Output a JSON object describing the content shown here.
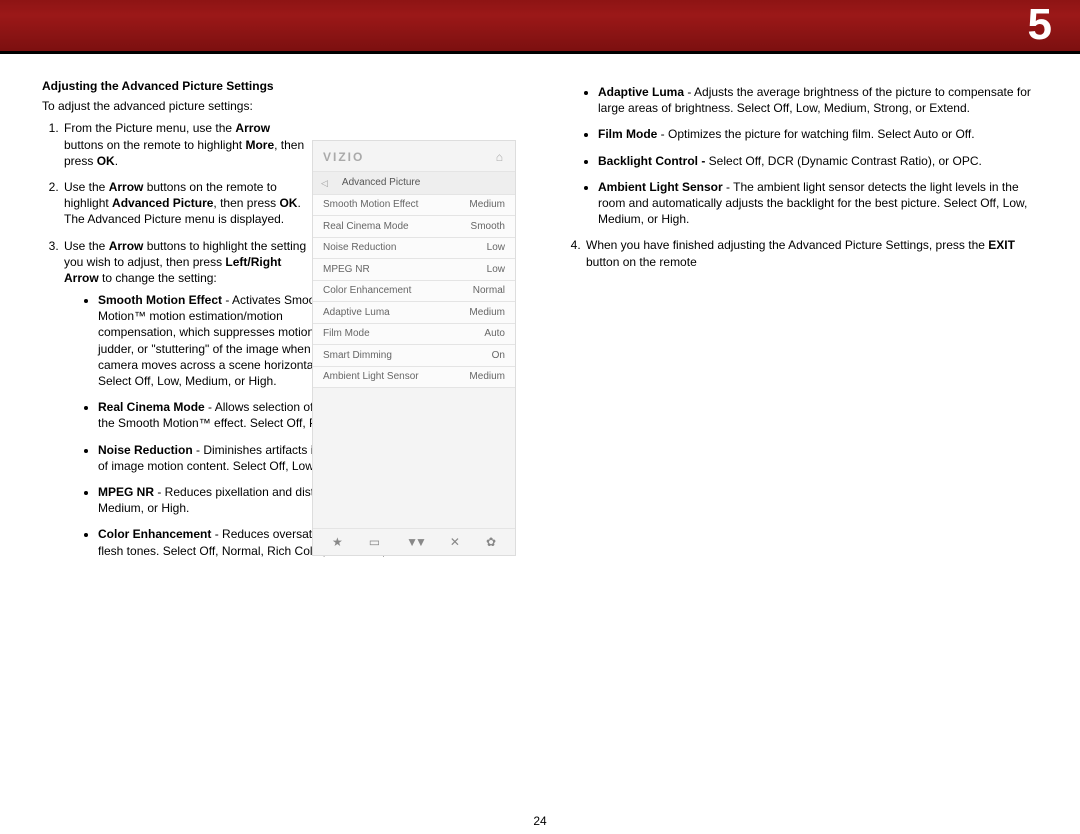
{
  "chapter": "5",
  "page_number": "24",
  "left": {
    "heading": "Adjusting the Advanced Picture Settings",
    "intro": "To adjust the advanced picture settings:",
    "step1_a": "From the Picture menu, use the ",
    "step1_b": "Arrow",
    "step1_c": " buttons on the remote to highlight ",
    "step1_d": "More",
    "step1_e": ", then press ",
    "step1_f": "OK",
    "step1_g": ".",
    "step2_a": "Use the ",
    "step2_b": "Arrow",
    "step2_c": " buttons on the remote to highlight ",
    "step2_d": "Advanced Picture",
    "step2_e": ", then press ",
    "step2_f": "OK",
    "step2_g": ". The Advanced Picture menu is displayed.",
    "step3_a": "Use the ",
    "step3_b": "Arrow",
    "step3_c": " buttons to highlight the setting you wish to adjust, then press ",
    "step3_d": "Left/Right Arrow",
    "step3_e": " to change the setting:",
    "items": {
      "sme_t": "Smooth Motion Effect",
      "sme_d": " - Activates Smooth Motion™ motion estimation/motion compensation, which suppresses motion judder, or \"stuttering\" of the image when the camera moves across a scene horizontally. Select Off, Low, Medium, or High.",
      "rcm_t": "Real Cinema Mode",
      "rcm_d": " - Allows selection of the type of compensation used for the Smooth Motion™ effect. Select Off, Precision or Smooth.",
      "nr_t": "Noise Reduction",
      "nr_d": " - Diminishes artifacts in the image caused by the digitizing of image motion content. Select Off, Low, Medium, or High.",
      "mpeg_t": "MPEG NR",
      "mpeg_d": " - Reduces pixellation and distortion for .mpeg files. Select Off, Low, Medium, or High.",
      "ce_t": "Color Enhancement",
      "ce_d": " - Reduces oversaturation of some colors and improves flesh tones. Select Off, Normal, Rich Color, Grn/Flesh, or Grn/Blue."
    }
  },
  "right": {
    "items": {
      "al_t": "Adaptive Luma",
      "al_d": " - Adjusts the average brightness of the picture to compensate for large areas of brightness. Select Off, Low, Medium, Strong, or Extend.",
      "fm_t": "Film Mode",
      "fm_d": " - Optimizes the picture for watching film. Select Auto or Off.",
      "bc_t": "Backlight Control - ",
      "bc_d": "Select Off, DCR (Dynamic Contrast Ratio), or OPC.",
      "als_t": "Ambient Light Sensor",
      "als_d": " - The ambient light sensor detects the light levels in the room and automatically adjusts the backlight for the best picture. Select Off, Low, Medium, or High."
    },
    "step4_a": "When you have finished adjusting the Advanced Picture Settings, press the ",
    "step4_b": "EXIT",
    "step4_c": " button on the remote"
  },
  "osd": {
    "logo": "VIZIO",
    "title": "Advanced Picture",
    "rows": [
      {
        "l": "Smooth Motion Effect",
        "r": "Medium"
      },
      {
        "l": "Real Cinema Mode",
        "r": "Smooth"
      },
      {
        "l": "Noise Reduction",
        "r": "Low"
      },
      {
        "l": "MPEG NR",
        "r": "Low"
      },
      {
        "l": "Color Enhancement",
        "r": "Normal"
      },
      {
        "l": "Adaptive Luma",
        "r": "Medium"
      },
      {
        "l": "Film Mode",
        "r": "Auto"
      },
      {
        "l": "Smart Dimming",
        "r": "On"
      },
      {
        "l": "Ambient Light Sensor",
        "r": "Medium"
      }
    ],
    "foot": {
      "star": "★",
      "cc": "▭",
      "v": "▾▾",
      "x": "✕",
      "gear": "✿"
    }
  }
}
